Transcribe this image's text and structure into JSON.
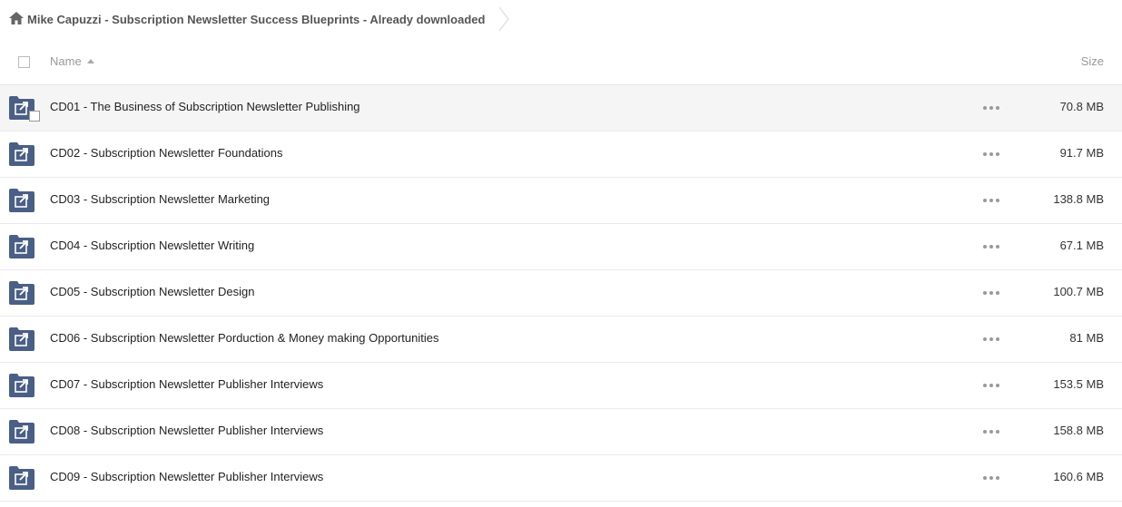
{
  "breadcrumb": {
    "folder": "Mike Capuzzi - Subscription Newsletter Success Blueprints - Already downloaded"
  },
  "header": {
    "name_label": "Name",
    "size_label": "Size"
  },
  "icons": {
    "home": "home-icon",
    "folder": "shared-folder-icon",
    "menu": "more-icon"
  },
  "colors": {
    "folder": "#4a5f86",
    "text": "#222222",
    "muted": "#999999"
  },
  "files": [
    {
      "name": "CD01 - The Business of Subscription Newsletter Publishing",
      "size": "70.8 MB"
    },
    {
      "name": "CD02 - Subscription Newsletter Foundations",
      "size": "91.7 MB"
    },
    {
      "name": "CD03 - Subscription Newsletter Marketing",
      "size": "138.8 MB"
    },
    {
      "name": "CD04 - Subscription Newsletter Writing",
      "size": "67.1 MB"
    },
    {
      "name": "CD05 - Subscription Newsletter Design",
      "size": "100.7 MB"
    },
    {
      "name": "CD06 - Subscription Newsletter Porduction & Money making Opportunities",
      "size": "81 MB"
    },
    {
      "name": "CD07 - Subscription Newsletter Publisher Interviews",
      "size": "153.5 MB"
    },
    {
      "name": "CD08 - Subscription Newsletter Publisher Interviews",
      "size": "158.8 MB"
    },
    {
      "name": "CD09 - Subscription Newsletter Publisher Interviews",
      "size": "160.6 MB"
    }
  ]
}
